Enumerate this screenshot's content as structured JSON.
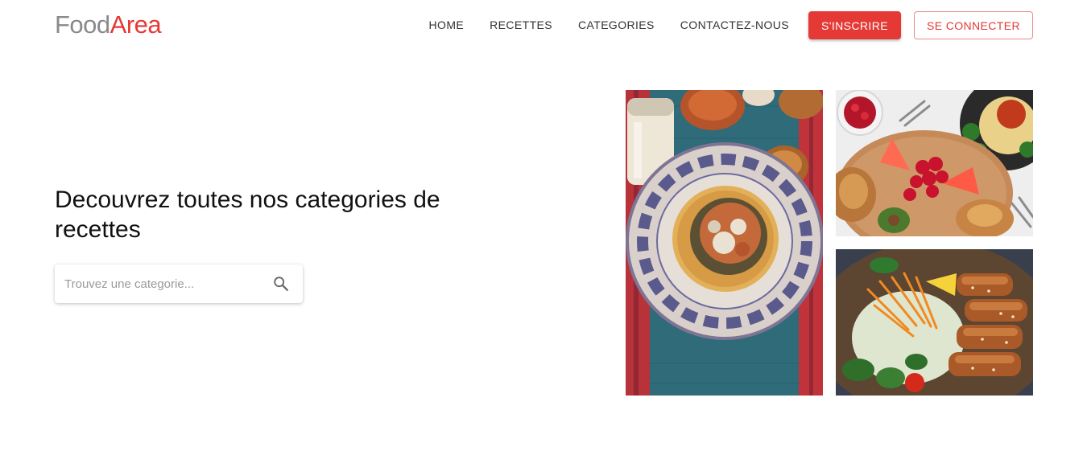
{
  "brand": {
    "part1": "Food",
    "part2": "Area"
  },
  "nav": {
    "items": [
      "HOME",
      "RECETTES",
      "CATEGORIES",
      "CONTACTEZ-NOUS"
    ],
    "signup": "S'INSCRIRE",
    "login": "SE CONNECTER"
  },
  "hero": {
    "title": "Decouvrez toutes nos categories de recettes",
    "search": {
      "placeholder": "Trouvez une categorie...",
      "value": ""
    },
    "search_icon": "search-icon"
  },
  "images": [
    "tacos-plate-photo",
    "fruits-brunch-photo",
    "chicken-salad-photo"
  ],
  "colors": {
    "accent": "#e53935",
    "logo_grey": "#8a8a8a"
  }
}
